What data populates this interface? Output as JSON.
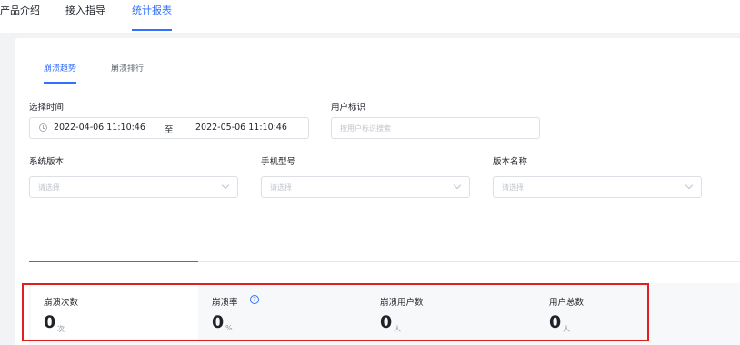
{
  "nav": {
    "tabs": [
      {
        "label": "产品介绍"
      },
      {
        "label": "接入指导"
      },
      {
        "label": "统计报表"
      }
    ]
  },
  "subtabs": [
    {
      "label": "崩溃趋势"
    },
    {
      "label": "崩溃排行"
    }
  ],
  "filters": {
    "time_label": "选择时间",
    "time_start": "2022-04-06 11:10:46",
    "time_sep": "至",
    "time_end": "2022-05-06 11:10:46",
    "user_id_label": "用户标识",
    "user_id_placeholder": "按用户标识搜索",
    "os_label": "系统版本",
    "os_placeholder": "请选择",
    "model_label": "手机型号",
    "model_placeholder": "请选择",
    "version_label": "版本名称",
    "version_placeholder": "请选择"
  },
  "stats": [
    {
      "label": "崩溃次数",
      "value": "0",
      "unit": "次"
    },
    {
      "label": "崩溃率",
      "value": "0",
      "unit": "%"
    },
    {
      "label": "崩溃用户数",
      "value": "0",
      "unit": "人"
    },
    {
      "label": "用户总数",
      "value": "0",
      "unit": "人"
    }
  ],
  "colors": {
    "accent": "#3370ff",
    "highlight_border": "#e02020"
  }
}
